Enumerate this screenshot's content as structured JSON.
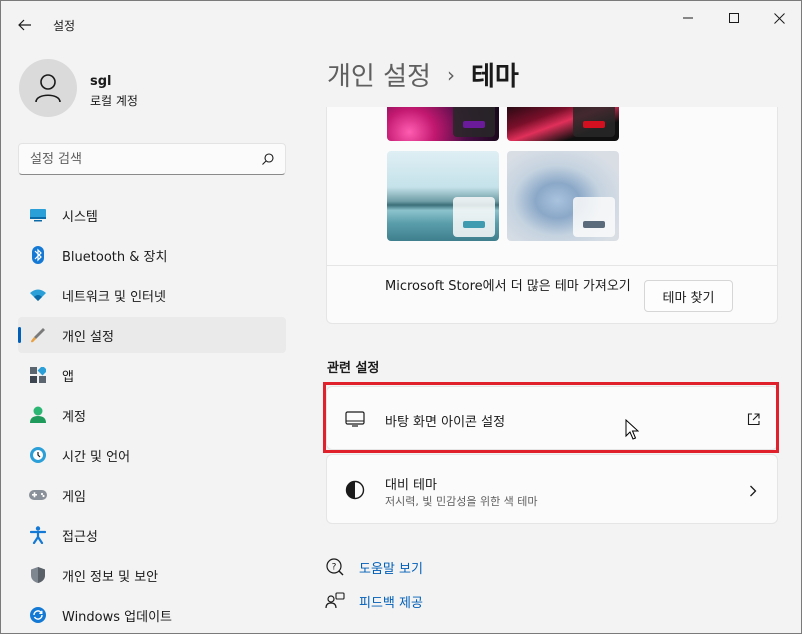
{
  "window": {
    "title": "설정",
    "controls": {
      "minimize": "minimize-icon",
      "maximize": "maximize-icon",
      "close": "close-icon"
    }
  },
  "profile": {
    "name": "sgl",
    "account_type": "로컬 계정"
  },
  "search": {
    "placeholder": "설정 검색"
  },
  "sidebar": {
    "items": [
      {
        "label": "시스템",
        "icon": "system-icon"
      },
      {
        "label": "Bluetooth & 장치",
        "icon": "bluetooth-icon"
      },
      {
        "label": "네트워크 및 인터넷",
        "icon": "network-icon"
      },
      {
        "label": "개인 설정",
        "icon": "personalization-icon",
        "active": true
      },
      {
        "label": "앱",
        "icon": "apps-icon"
      },
      {
        "label": "계정",
        "icon": "accounts-icon"
      },
      {
        "label": "시간 및 언어",
        "icon": "time-language-icon"
      },
      {
        "label": "게임",
        "icon": "gaming-icon"
      },
      {
        "label": "접근성",
        "icon": "accessibility-icon"
      },
      {
        "label": "개인 정보 및 보안",
        "icon": "privacy-icon"
      },
      {
        "label": "Windows 업데이트",
        "icon": "update-icon"
      }
    ]
  },
  "breadcrumb": {
    "parent": "개인 설정",
    "separator": "›",
    "current": "테마"
  },
  "themes": {
    "store_text": "Microsoft Store에서 더 많은 테마 가져오기",
    "find_button": "테마 찾기",
    "swatches": [
      "#6a1b9a",
      "#d3101f",
      "#3f9bb0",
      "#5c6b7c"
    ]
  },
  "related": {
    "title": "관련 설정",
    "items": [
      {
        "title": "바탕 화면 아이콘 설정",
        "icon": "desktop-icon",
        "trailing": "open-external-icon"
      },
      {
        "title": "대비 테마",
        "subtitle": "저시력, 빛 민감성을 위한 색 테마",
        "icon": "contrast-icon",
        "trailing": "chevron-right-icon"
      }
    ]
  },
  "links": {
    "help": "도움말 보기",
    "feedback": "피드백 제공"
  },
  "colors": {
    "accent": "#005fb8",
    "highlight": "#e0202a"
  }
}
